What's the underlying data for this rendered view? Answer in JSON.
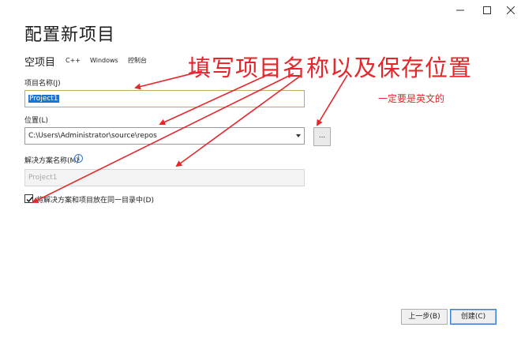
{
  "window": {
    "minimize_glyph": "─",
    "maximize_glyph": "☐",
    "close_glyph": "✕"
  },
  "dialog": {
    "title": "配置新项目",
    "template_name": "空项目",
    "tags": [
      "C++",
      "Windows",
      "控制台"
    ]
  },
  "form": {
    "project_name_label": "项目名称(J)",
    "project_name_value": "Project1",
    "location_label": "位置(L)",
    "location_value": "C:\\Users\\Administrator\\source\\repos",
    "browse_label": "...",
    "solution_name_label": "解决方案名称(M)",
    "solution_name_placeholder": "Project1",
    "same_dir_checkbox_label": "将解决方案和项目放在同一目录中(D)",
    "same_dir_checked": true
  },
  "footer": {
    "back_label": "上一步(B)",
    "create_label": "创建(C)"
  },
  "annotations": {
    "main_text": "填写项目名称以及保存位置",
    "sub_text": "一定要是英文的",
    "color": "#e5262b"
  },
  "icons": {
    "info": "info-icon",
    "checkmark": "checkmark-icon",
    "dropdown": "chevron-down-icon"
  }
}
